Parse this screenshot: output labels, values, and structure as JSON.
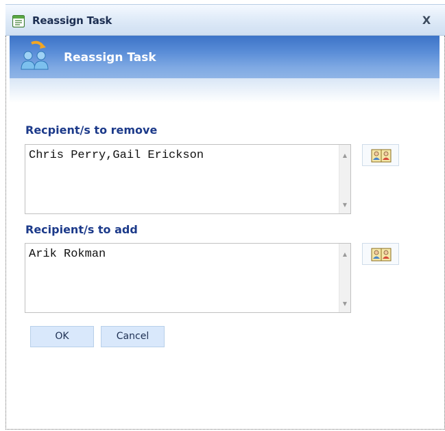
{
  "window": {
    "title": "Reassign Task",
    "close_label": "X"
  },
  "header": {
    "title": "Reassign Task"
  },
  "remove_section": {
    "label": "Recpient/s to remove",
    "value": "Chris Perry,Gail Erickson"
  },
  "add_section": {
    "label": "Recipient/s to add",
    "value": "Arik Rokman"
  },
  "buttons": {
    "ok": "OK",
    "cancel": "Cancel"
  },
  "colors": {
    "section_label": "#1c3a8a",
    "header_band": "#5b8ed8",
    "button_bg": "#d9e8fb"
  }
}
